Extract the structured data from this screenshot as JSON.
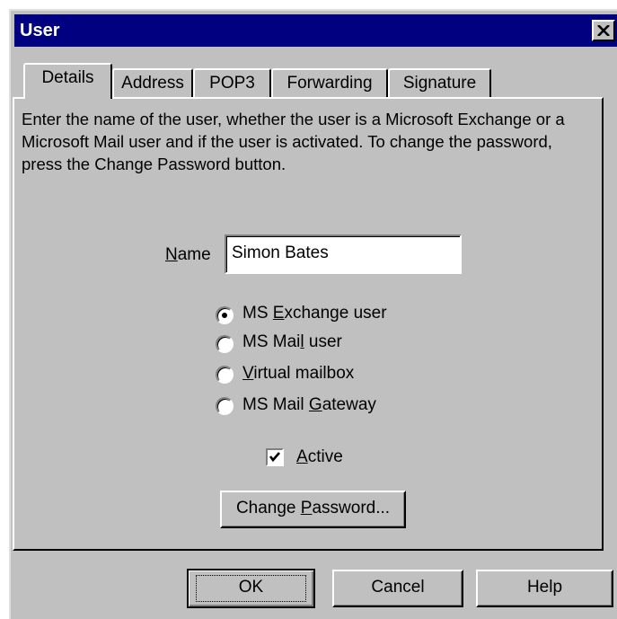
{
  "window": {
    "title": "User"
  },
  "tabs": [
    {
      "label": "Details",
      "active": true
    },
    {
      "label": "Address",
      "active": false
    },
    {
      "label": "POP3",
      "active": false
    },
    {
      "label": "Forwarding",
      "active": false
    },
    {
      "label": "Signature",
      "active": false
    }
  ],
  "description": "Enter the name of the user, whether the user is a Microsoft Exchange or a Microsoft Mail user and if the user is activated. To change the password, press the Change Password button.",
  "name_field": {
    "label_access": "N",
    "label_rest": "ame",
    "value": "Simon Bates"
  },
  "user_type": {
    "selected": "MS Exchange user",
    "options": [
      {
        "pre": "MS ",
        "access": "E",
        "post": "xchange user"
      },
      {
        "pre": "MS Mai",
        "access": "l",
        "post": " user"
      },
      {
        "pre": "",
        "access": "V",
        "post": "irtual mailbox"
      },
      {
        "pre": "MS Mail ",
        "access": "G",
        "post": "ateway"
      }
    ]
  },
  "active": {
    "checked": true,
    "access": "A",
    "post": "ctive"
  },
  "change_password": {
    "pre": "Change ",
    "access": "P",
    "post": "assword..."
  },
  "buttons": {
    "ok": "OK",
    "cancel": "Cancel",
    "help": "Help"
  },
  "icons": {
    "close": "close-icon",
    "check": "checkmark-icon"
  },
  "colors": {
    "titlebar": "#000080",
    "face": "#c0c0c0"
  }
}
